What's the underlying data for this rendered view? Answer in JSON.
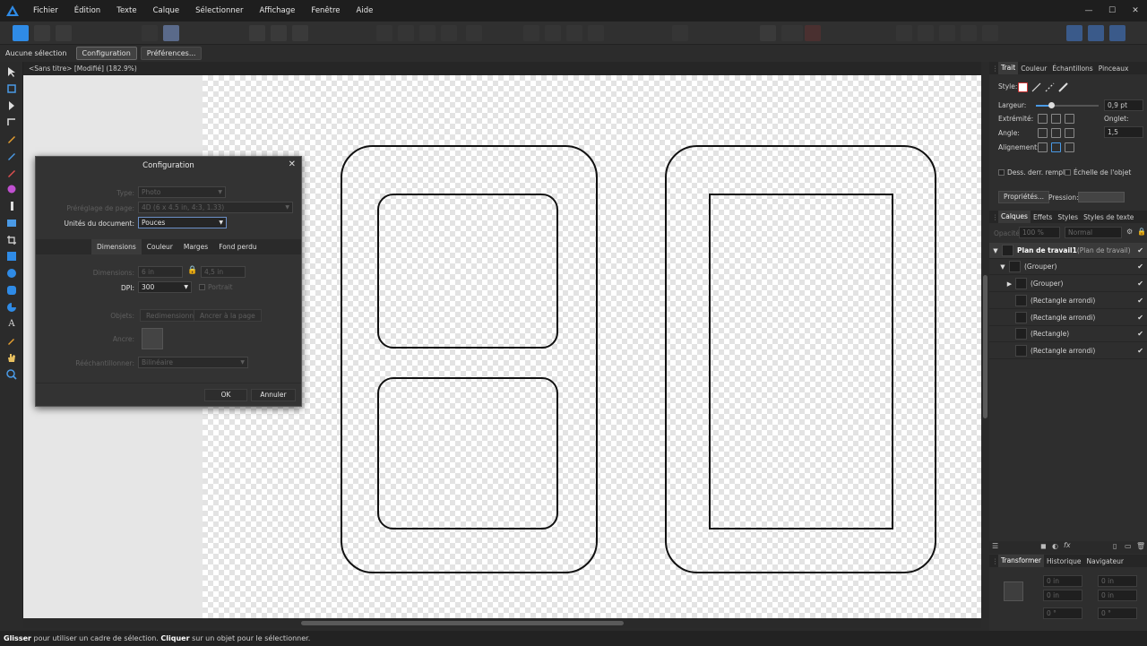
{
  "menu": [
    "Fichier",
    "Édition",
    "Texte",
    "Calque",
    "Sélectionner",
    "Affichage",
    "Fenêtre",
    "Aide"
  ],
  "window_controls": [
    "—",
    "☐",
    "✕"
  ],
  "context": {
    "selection": "Aucune sélection",
    "config_btn": "Configuration",
    "prefs_btn": "Préférences..."
  },
  "document": {
    "tab": "<Sans titre> [Modifié] (182.9%)"
  },
  "status": {
    "drag": "Glisser",
    "drag_text": " pour utiliser un cadre de sélection. ",
    "click": "Cliquer",
    "click_text": " sur un objet pour le sélectionner."
  },
  "stroke_panel": {
    "tabs": [
      "Trait",
      "Couleur",
      "Échantillons",
      "Pinceaux"
    ],
    "style_label": "Style:",
    "width_label": "Largeur:",
    "width_value": "0,9 pt",
    "cap_label": "Extrémité:",
    "join_label": "Onglet:",
    "join_value": "1,5",
    "angle_label": "Angle:",
    "align_label": "Alignement:",
    "draw_behind": "Dess. derr. rempl",
    "scale_object": "Échelle de l'objet",
    "props_btn": "Propriétés...",
    "pressure_label": "Pression:"
  },
  "layers_panel": {
    "tabs": [
      "Calques",
      "Effets",
      "Styles",
      "Styles de texte"
    ],
    "opacity_label": "Opacité:",
    "opacity_value": "100 %",
    "blend_value": "Normal",
    "rows": [
      {
        "name": "Plan de travail1",
        "sub": " (Plan de travail)"
      },
      {
        "name": "(Grouper)"
      },
      {
        "name": "(Grouper)"
      },
      {
        "name": "(Rectangle arrondi)"
      },
      {
        "name": "(Rectangle arrondi)"
      },
      {
        "name": "(Rectangle)"
      },
      {
        "name": "(Rectangle arrondi)"
      }
    ]
  },
  "transform_panel": {
    "tabs": [
      "Transformer",
      "Historique",
      "Navigateur"
    ],
    "x_value": "0 in",
    "y_value": "0 in",
    "w_value": "0 in",
    "h_value": "0 in",
    "r_value": "0 °",
    "s_value": "0 °"
  },
  "dialog": {
    "title": "Configuration",
    "type_label": "Type:",
    "type_value": "Photo",
    "preset_label": "Préréglage de page:",
    "preset_value": "4D  (6 x 4.5 in, 4:3, 1.33)",
    "units_label": "Unités du document:",
    "units_value": "Pouces",
    "tabs": [
      "Dimensions",
      "Couleur",
      "Marges",
      "Fond perdu"
    ],
    "dims_label": "Dimensions:",
    "width_value": "6 in",
    "height_value": "4,5 in",
    "dpi_label": "DPI:",
    "dpi_value": "300",
    "portrait_label": "Portrait",
    "objects_label": "Objets:",
    "resize_btn": "Redimensionner",
    "anchor_btn": "Ancrer à la page",
    "anchor_label": "Ancre:",
    "resample_label": "Rééchantillonner:",
    "resample_value": "Bilinéaire",
    "ok": "OK",
    "cancel": "Annuler"
  }
}
